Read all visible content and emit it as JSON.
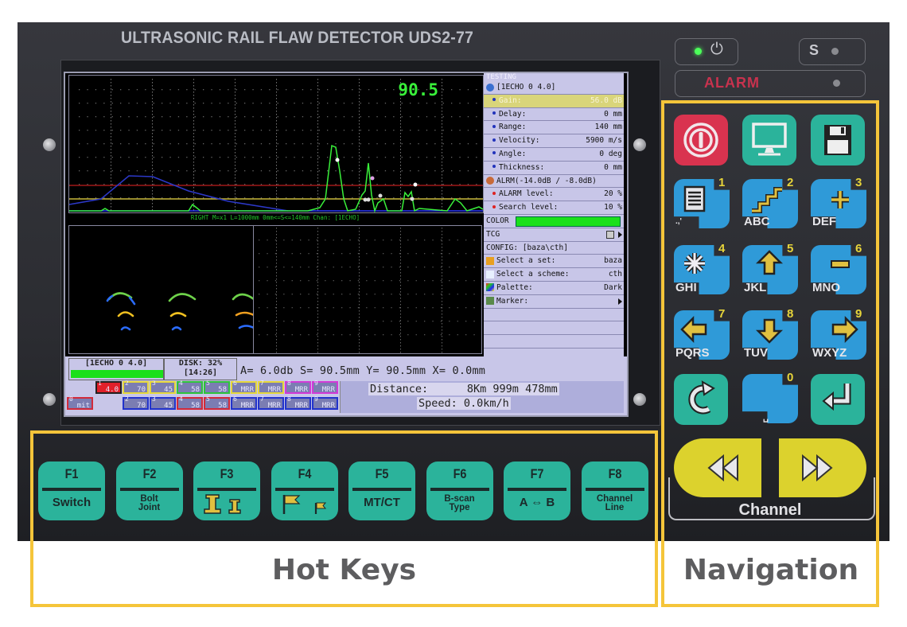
{
  "device": {
    "title": "ULTRASONIC RAIL FLAW DETECTOR UDS2-77",
    "indicators": {
      "power_led": "on",
      "power_symbol": "⏻",
      "s_label": "S",
      "alarm_label": "ALARM"
    }
  },
  "screen": {
    "ascan": {
      "reading": "90.5",
      "alarm_threshold_percent": 20,
      "search_threshold_percent": 10
    },
    "status_line": "RIGHT M=x1  L=1000mm 0mm<=S<=140mm Chan: [1ECHO]",
    "menu": {
      "header": "TESTING",
      "channel_title": "[1ECHO 0 4.0]",
      "params": [
        {
          "label": "Gain:",
          "value": "56.0 dB",
          "selected": true
        },
        {
          "label": "Delay:",
          "value": "0 mm"
        },
        {
          "label": "Range:",
          "value": "140 mm"
        },
        {
          "label": "Velocity:",
          "value": "5900 m/s"
        },
        {
          "label": "Angle:",
          "value": "0 deg"
        },
        {
          "label": "Thickness:",
          "value": "0 mm"
        }
      ],
      "alarm_title": "ALRM(-14.0dB / -8.0dB)",
      "alarm_params": [
        {
          "label": "ALARM level:",
          "value": "20 %"
        },
        {
          "label": "Search level:",
          "value": "10 %"
        }
      ],
      "color_label": "COLOR",
      "color_value": "#1be01b",
      "tcg_label": "TCG",
      "config_title": "CONFIG: [baza\\cth]",
      "config_items": [
        {
          "icon": "folder-icon",
          "label": "Select a set:",
          "value": "baza"
        },
        {
          "icon": "document-icon",
          "label": "Select a scheme:",
          "value": "cth"
        },
        {
          "icon": "palette-icon",
          "label": "Palette:",
          "value": "Dark"
        },
        {
          "icon": "marker-icon",
          "label": "Marker:",
          "value": ""
        }
      ]
    },
    "bottom": {
      "channel_box": "[1ECHO 0 4.0]",
      "disk": "DISK: 32%",
      "time": "[14:26]",
      "coords": "A= 6.0db S= 90.5mm Y= 90.5mm X=  0.0mm",
      "channel_tiles_top": [
        {
          "n": "1",
          "v": "4.0",
          "color": "#e0202a",
          "border": "#222"
        },
        {
          "n": "2",
          "v": "70",
          "color": "#7b7db2",
          "border": "#e6d83a"
        },
        {
          "n": "3",
          "v": "45",
          "color": "#7b7db2",
          "border": "#e6d83a"
        },
        {
          "n": "4",
          "v": "58",
          "color": "#7b7db2",
          "border": "#2ec43a"
        },
        {
          "n": "5",
          "v": "58",
          "color": "#7b7db2",
          "border": "#2ec43a"
        },
        {
          "n": "6",
          "v": "MRR",
          "color": "#7b7db2",
          "border": "#e6d83a"
        },
        {
          "n": "7",
          "v": "MRR",
          "color": "#7b7db2",
          "border": "#e6d83a"
        },
        {
          "n": "8",
          "v": "MRR",
          "color": "#7b7db2",
          "border": "#d23ad8"
        },
        {
          "n": "9",
          "v": "MRR",
          "color": "#7b7db2",
          "border": "#d23ad8"
        }
      ],
      "channel_tiles_bottom": [
        {
          "n": "0",
          "v": "mit",
          "color": "#7b7db2",
          "border": "#d22a3a"
        },
        {
          "n": "2",
          "v": "70",
          "color": "#7b7db2",
          "border": "#2233cc"
        },
        {
          "n": "3",
          "v": "45",
          "color": "#7b7db2",
          "border": "#2233cc"
        },
        {
          "n": "4",
          "v": "58",
          "color": "#7b7db2",
          "border": "#d22a3a"
        },
        {
          "n": "5",
          "v": "58",
          "color": "#7b7db2",
          "border": "#d22a3a"
        },
        {
          "n": "6",
          "v": "MRR",
          "color": "#7b7db2",
          "border": "#2233cc"
        },
        {
          "n": "7",
          "v": "MRR",
          "color": "#7b7db2",
          "border": "#2233cc"
        },
        {
          "n": "8",
          "v": "MRR",
          "color": "#7b7db2",
          "border": "#2233cc"
        },
        {
          "n": "9",
          "v": "MRR",
          "color": "#7b7db2",
          "border": "#2233cc"
        }
      ],
      "distance": "Distance:      8Km 999m 478mm",
      "speed": "Speed: 0.0km/h"
    }
  },
  "hotkeys": [
    {
      "name": "F1",
      "label": "Switch",
      "icon": ""
    },
    {
      "name": "F2",
      "label": "Bolt\nJoint",
      "icon": ""
    },
    {
      "name": "F3",
      "label": "",
      "icon": "rail-profile-icon"
    },
    {
      "name": "F4",
      "label": "",
      "icon": "flag-icon"
    },
    {
      "name": "F5",
      "label": "MT/CT",
      "icon": ""
    },
    {
      "name": "F6",
      "label": "B-scan\nType",
      "icon": ""
    },
    {
      "name": "F7",
      "label": "A ⇔ B",
      "icon": ""
    },
    {
      "name": "F8",
      "label": "Channel\nLine",
      "icon": ""
    }
  ],
  "navigation": {
    "keys": [
      {
        "id": "power",
        "icon": "power-icon",
        "num": "",
        "letters": ""
      },
      {
        "id": "display",
        "icon": "monitor-icon",
        "num": "",
        "letters": ""
      },
      {
        "id": "save",
        "icon": "floppy-disk-icon",
        "num": "",
        "letters": ""
      },
      {
        "id": "k1",
        "icon": "list-icon",
        "num": "1",
        "letters": ".,'"
      },
      {
        "id": "k2",
        "icon": "stairs-icon",
        "num": "2",
        "letters": "ABC"
      },
      {
        "id": "k3",
        "icon": "plus-icon",
        "num": "3",
        "letters": "DEF"
      },
      {
        "id": "k4",
        "icon": "asterisk-icon",
        "num": "4",
        "letters": "GHI"
      },
      {
        "id": "k5",
        "icon": "arrow-up-icon",
        "num": "5",
        "letters": "JKL"
      },
      {
        "id": "k6",
        "icon": "minus-icon",
        "num": "6",
        "letters": "MNO"
      },
      {
        "id": "k7",
        "icon": "arrow-left-icon",
        "num": "7",
        "letters": "PQRS"
      },
      {
        "id": "k8",
        "icon": "arrow-down-icon",
        "num": "8",
        "letters": "TUV"
      },
      {
        "id": "k9",
        "icon": "arrow-right-icon",
        "num": "9",
        "letters": "WXYZ"
      },
      {
        "id": "back",
        "icon": "redo-icon",
        "num": "",
        "letters": ""
      },
      {
        "id": "k0",
        "icon": "",
        "num": "0",
        "letters": "␣"
      },
      {
        "id": "enter",
        "icon": "enter-icon",
        "num": "",
        "letters": ""
      }
    ],
    "channel_label": "Channel",
    "channel_prev_icon": "rewind-icon",
    "channel_next_icon": "fast-forward-icon"
  },
  "captions": {
    "hotkeys": "Hot Keys",
    "navigation": "Navigation"
  },
  "colors": {
    "frame": "#f5c53a",
    "key_teal": "#2bb39b",
    "key_blue": "#2f9ad8",
    "key_red": "#d9334f",
    "key_yellow": "#dcd22d",
    "screen_menu_bg": "#c8c6e8",
    "trace_green": "#39f03a"
  }
}
